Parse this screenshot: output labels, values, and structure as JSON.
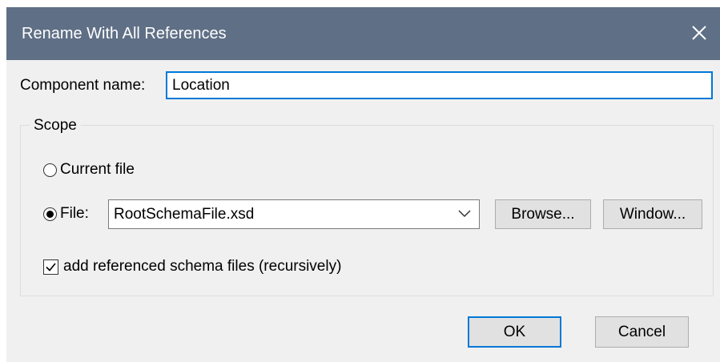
{
  "dialog": {
    "title": "Rename With All References",
    "component_name_label": "Component name:",
    "component_name_value": "Location",
    "scope": {
      "legend": "Scope",
      "current_file_label": "Current file",
      "current_file_checked": false,
      "file_label": "File:",
      "file_checked": true,
      "file_value": "RootSchemaFile.xsd",
      "browse_label": "Browse...",
      "window_label": "Window...",
      "recursive_label": "add referenced schema files (recursively)",
      "recursive_checked": true
    },
    "ok_label": "OK",
    "cancel_label": "Cancel"
  },
  "icons": {
    "close": "close-icon",
    "dropdown": "chevron-down-icon",
    "check": "checkmark-icon"
  },
  "colors": {
    "titlebar": "#5f6f86",
    "dialog_bg": "#f0f0f0",
    "focus_accent": "#0078d7",
    "button_bg": "#e1e1e1"
  }
}
